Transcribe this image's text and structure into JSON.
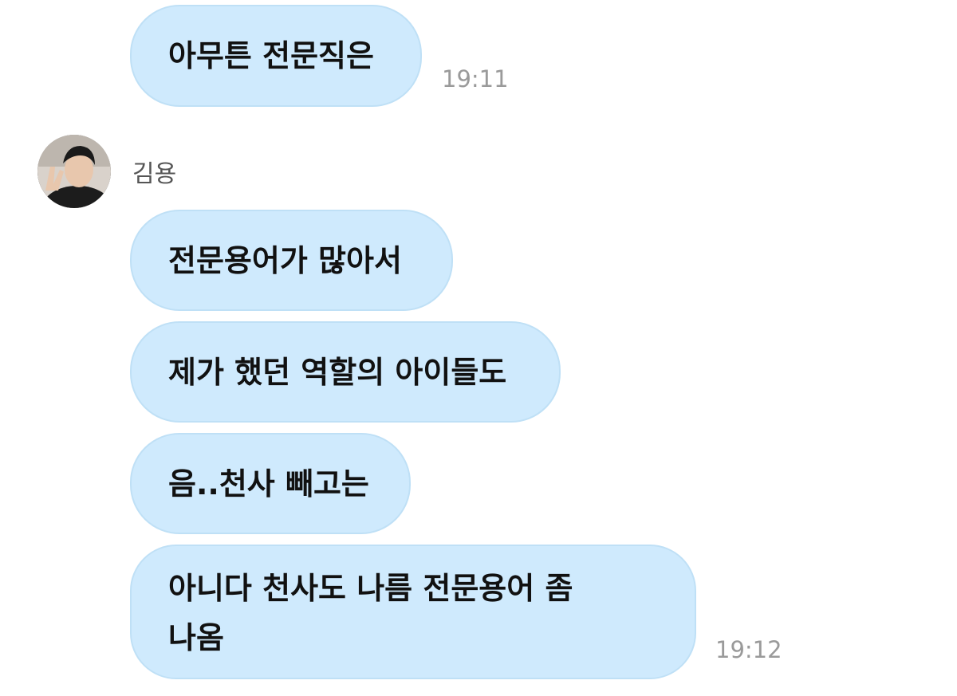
{
  "messages_top": {
    "text": "아무튼 전문직은",
    "time": "19:11"
  },
  "sender": {
    "name": "김용",
    "avatar_icon": "profile-photo-peace-sign"
  },
  "messages": [
    {
      "text": "전문용어가 많아서"
    },
    {
      "text": "제가 했던 역할의 아이들도"
    },
    {
      "text": "음..천사 빼고는"
    },
    {
      "text": "아니다 천사도 나름 전문용어 좀\n나옴",
      "time": "19:12"
    }
  ],
  "colors": {
    "bubble": "#cfeafd",
    "bubble_border": "#bfe0f6",
    "text": "#111111",
    "timestamp": "#9a9a9a",
    "background": "#ffffff"
  }
}
